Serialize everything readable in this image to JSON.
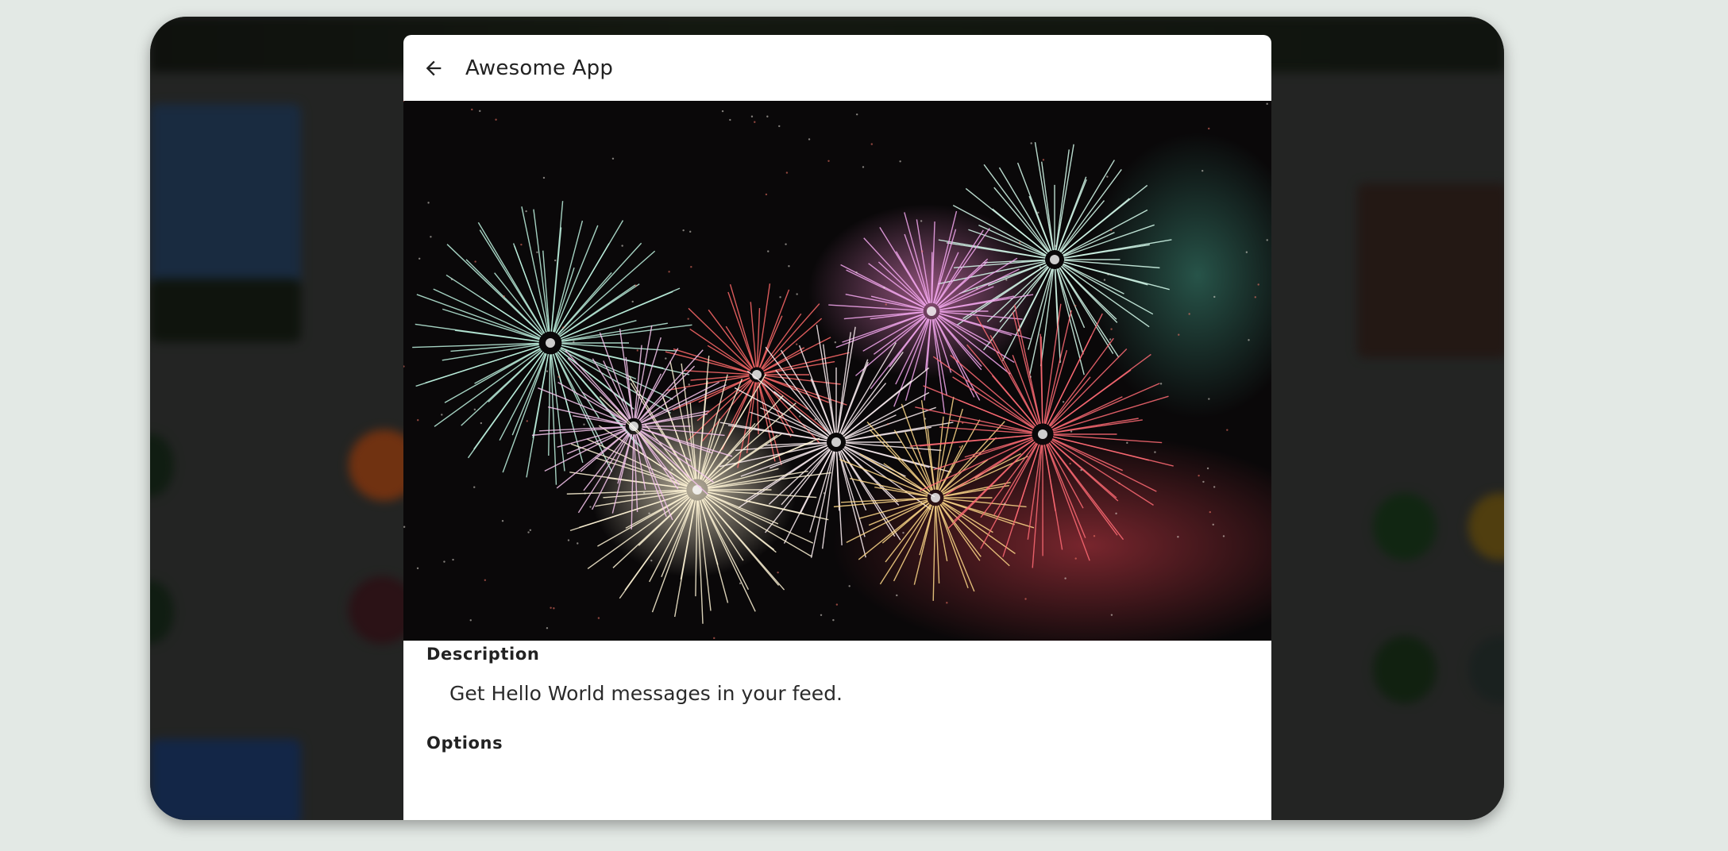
{
  "dialog": {
    "title": "Awesome App",
    "back_icon": "arrow-left-icon",
    "hero_image": "fireworks-photo",
    "description_label": "Description",
    "description_text": "Get Hello World messages in your feed.",
    "options_label": "Options"
  },
  "colors": {
    "scrim": "#000000",
    "page_background": "#e3e9e5",
    "dialog_background": "#ffffff",
    "text": "#222222"
  }
}
